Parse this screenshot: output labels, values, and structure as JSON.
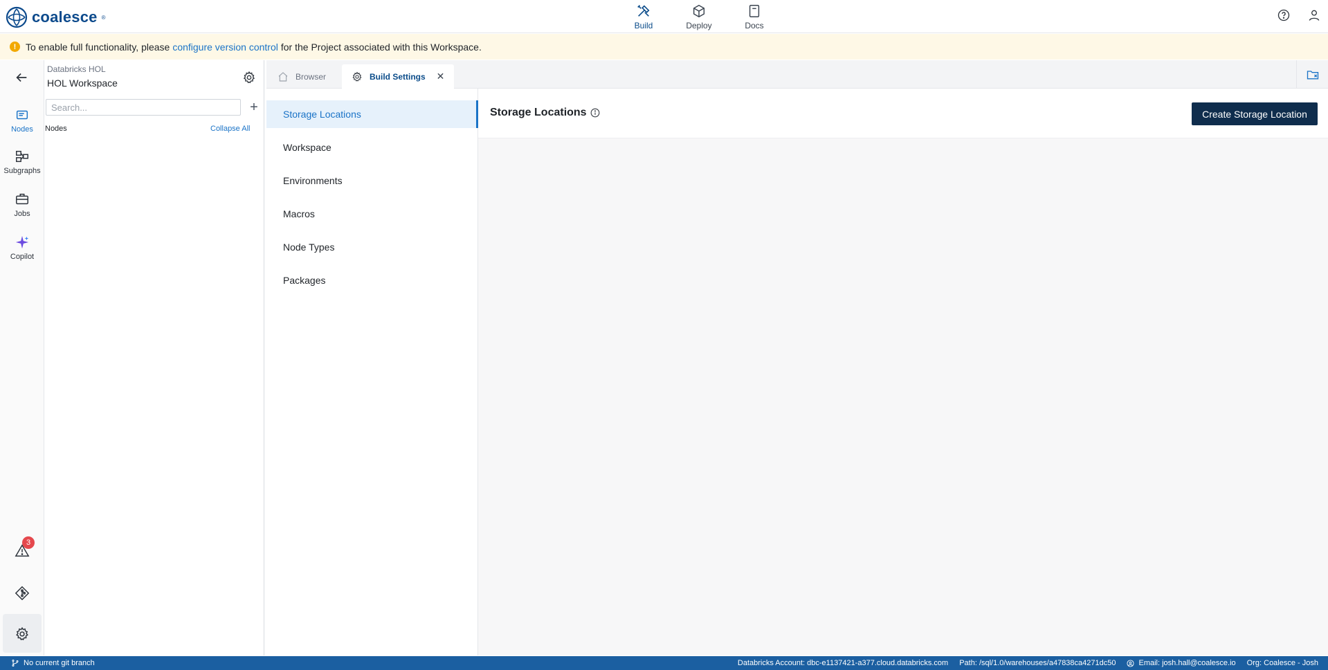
{
  "brand": {
    "name": "coalesce",
    "reg": "®"
  },
  "top_nav": {
    "tabs": [
      {
        "label": "Build",
        "icon": "build-icon",
        "active": true
      },
      {
        "label": "Deploy",
        "icon": "deploy-icon"
      },
      {
        "label": "Docs",
        "icon": "docs-icon"
      }
    ]
  },
  "banner": {
    "prefix": "To enable full functionality, please",
    "link": "configure version control",
    "suffix": "for the Project associated with this Workspace."
  },
  "rail": {
    "items": [
      {
        "label": "Nodes",
        "icon": "nodes-icon",
        "active": true
      },
      {
        "label": "Subgraphs",
        "icon": "subgraphs-icon"
      },
      {
        "label": "Jobs",
        "icon": "jobs-icon"
      },
      {
        "label": "Copilot",
        "icon": "copilot-icon"
      }
    ],
    "alerts_count": "3"
  },
  "panel": {
    "project": "Databricks HOL",
    "workspace": "HOL Workspace",
    "search_placeholder": "Search...",
    "nodes_header": "Nodes",
    "collapse_all": "Collapse All"
  },
  "tabs": [
    {
      "label": "Browser",
      "icon": "home-icon"
    },
    {
      "label": "Build Settings",
      "icon": "settings-icon",
      "active": true
    }
  ],
  "settings_nav": {
    "items": [
      "Storage Locations",
      "Workspace",
      "Environments",
      "Macros",
      "Node Types",
      "Packages"
    ],
    "active": "Storage Locations"
  },
  "content": {
    "title": "Storage Locations",
    "create_button": "Create Storage Location"
  },
  "status_bar": {
    "branch": "No current git branch",
    "account": "Databricks Account: dbc-e1137421-a377.cloud.databricks.com",
    "path": "Path: /sql/1.0/warehouses/a47838ca4271dc50",
    "email": "Email: josh.hall@coalesce.io",
    "org": "Org: Coalesce - Josh"
  },
  "colors": {
    "accent": "#1a73c7",
    "primary_dark": "#0f2d4d",
    "status_bar": "#1b5fa1",
    "banner": "#fef8e6",
    "alert": "#e5484d"
  }
}
